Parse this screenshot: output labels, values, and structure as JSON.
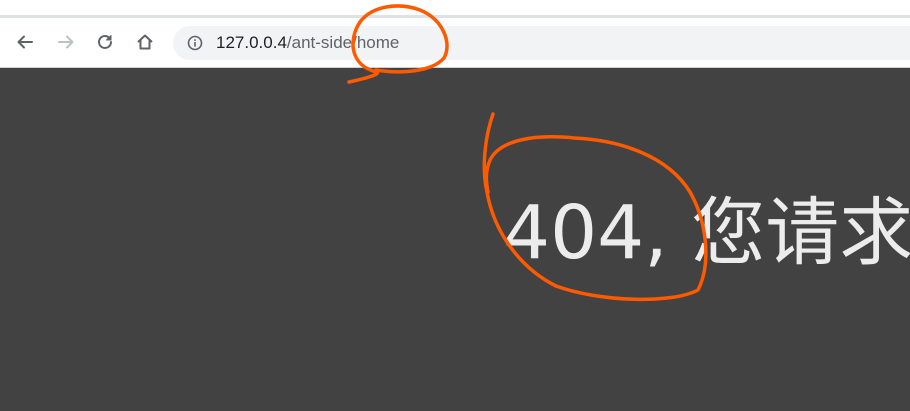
{
  "browser": {
    "url_host": "127.0.0.4",
    "url_path": "/ant-side/home",
    "icons": {
      "back": "arrow-left-icon",
      "forward": "arrow-right-icon",
      "reload": "reload-icon",
      "home": "home-icon",
      "site_info": "info-circle-icon"
    }
  },
  "page": {
    "message": "404, 您请求"
  },
  "colors": {
    "content_bg": "#424242",
    "message_text": "#ececec",
    "annotation_stroke": "#ff5a00",
    "omnibox_bg": "#f1f3f4"
  }
}
